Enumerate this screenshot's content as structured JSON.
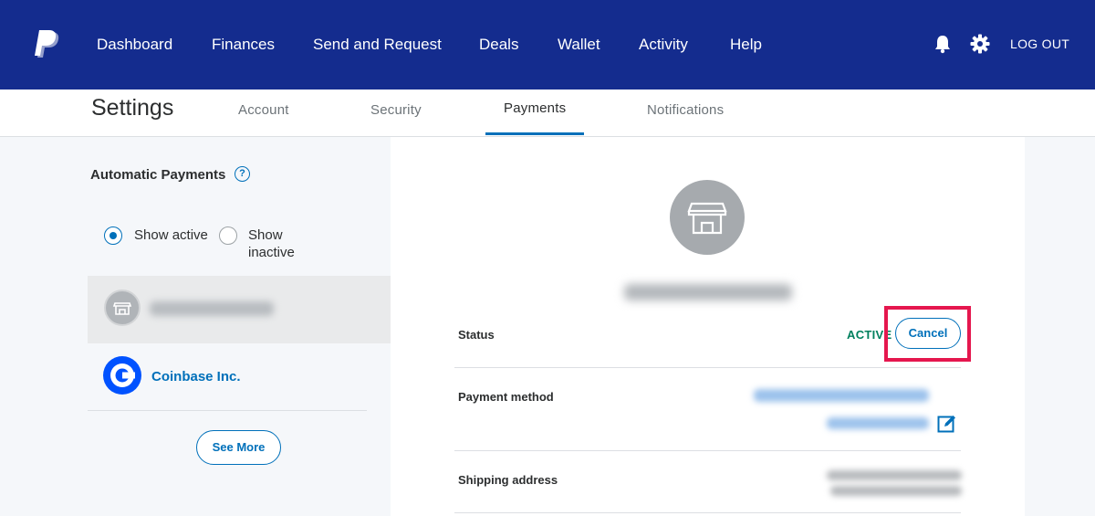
{
  "topnav": {
    "items": [
      "Dashboard",
      "Finances",
      "Send and Request",
      "Deals",
      "Wallet",
      "Activity",
      "Help"
    ],
    "logout": "LOG OUT",
    "icons": [
      "paypal-logo",
      "bell-icon",
      "gear-icon"
    ]
  },
  "settings": {
    "title": "Settings",
    "tabs": [
      "Account",
      "Security",
      "Payments",
      "Notifications"
    ],
    "active_tab": "Payments"
  },
  "automatic_payments": {
    "title": "Automatic Payments",
    "help": "?",
    "filter_active": "Show active",
    "filter_inactive_line1": "Show",
    "filter_inactive_line2": "inactive",
    "selected_filter": "Show active",
    "merchants": [
      {
        "name": "Coinbase Inc."
      }
    ],
    "see_more": "See More"
  },
  "detail": {
    "status_label": "Status",
    "status_value": "ACTIVE",
    "cancel": "Cancel",
    "payment_method_label": "Payment method",
    "shipping_address_label": "Shipping address"
  },
  "colors": {
    "nav_bg": "#142c8e",
    "accent": "#0070ba",
    "status_active": "#01805e",
    "highlight": "#e5174e"
  }
}
